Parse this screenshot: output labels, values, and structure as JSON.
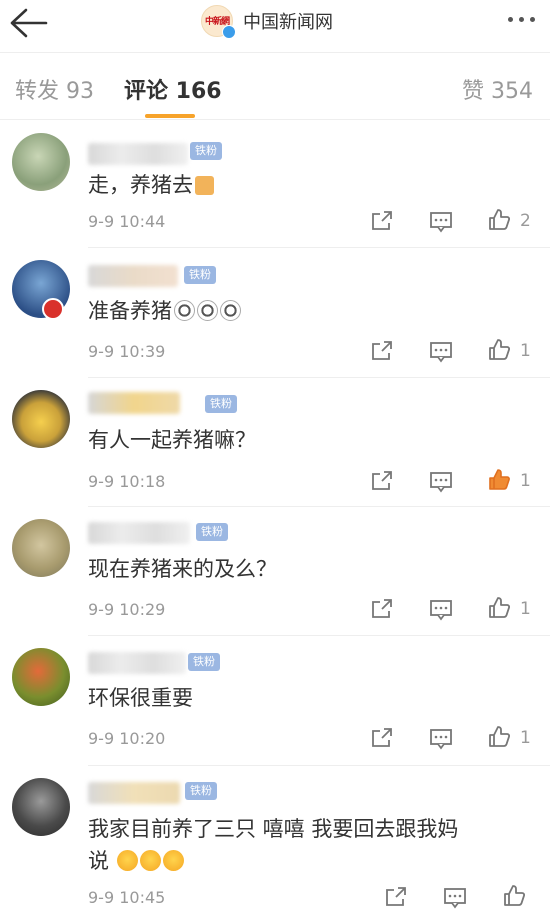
{
  "header": {
    "back_icon": "arrow-left-icon",
    "logo_text": "中新網",
    "account_name": "中国新闻网",
    "more_icon": "more-dots-icon"
  },
  "tabs": [
    {
      "label": "转发 93",
      "active": false
    },
    {
      "label": "评论 166",
      "active": true
    },
    {
      "label": "赞 354",
      "active": false
    }
  ],
  "colors": {
    "accent": "#f7a32a",
    "badge": "#9bb7e2",
    "liked": "#f08b33",
    "text_muted": "#999999"
  },
  "comments": [
    {
      "badge": "铁粉",
      "text": "走，养猪去",
      "time": "9-9 10:44",
      "likes": "2",
      "liked": false
    },
    {
      "badge": "铁粉",
      "text": "准备养猪",
      "time": "9-9 10:39",
      "likes": "1",
      "liked": false
    },
    {
      "badge": "铁粉",
      "text": "有人一起养猪嘛？",
      "time": "9-9 10:18",
      "likes": "1",
      "liked": true
    },
    {
      "badge": "铁粉",
      "text": "现在养猪来的及么？",
      "time": "9-9 10:29",
      "likes": "1",
      "liked": false
    },
    {
      "badge": "铁粉",
      "text": "环保很重要",
      "time": "9-9 10:20",
      "likes": "1",
      "liked": false
    },
    {
      "badge": "铁粉",
      "text_line1": "我家目前养了三只   嘻嘻  我要回去跟我妈",
      "text_line2": "说",
      "time": "9-9 10:45",
      "likes": "",
      "liked": false
    }
  ]
}
